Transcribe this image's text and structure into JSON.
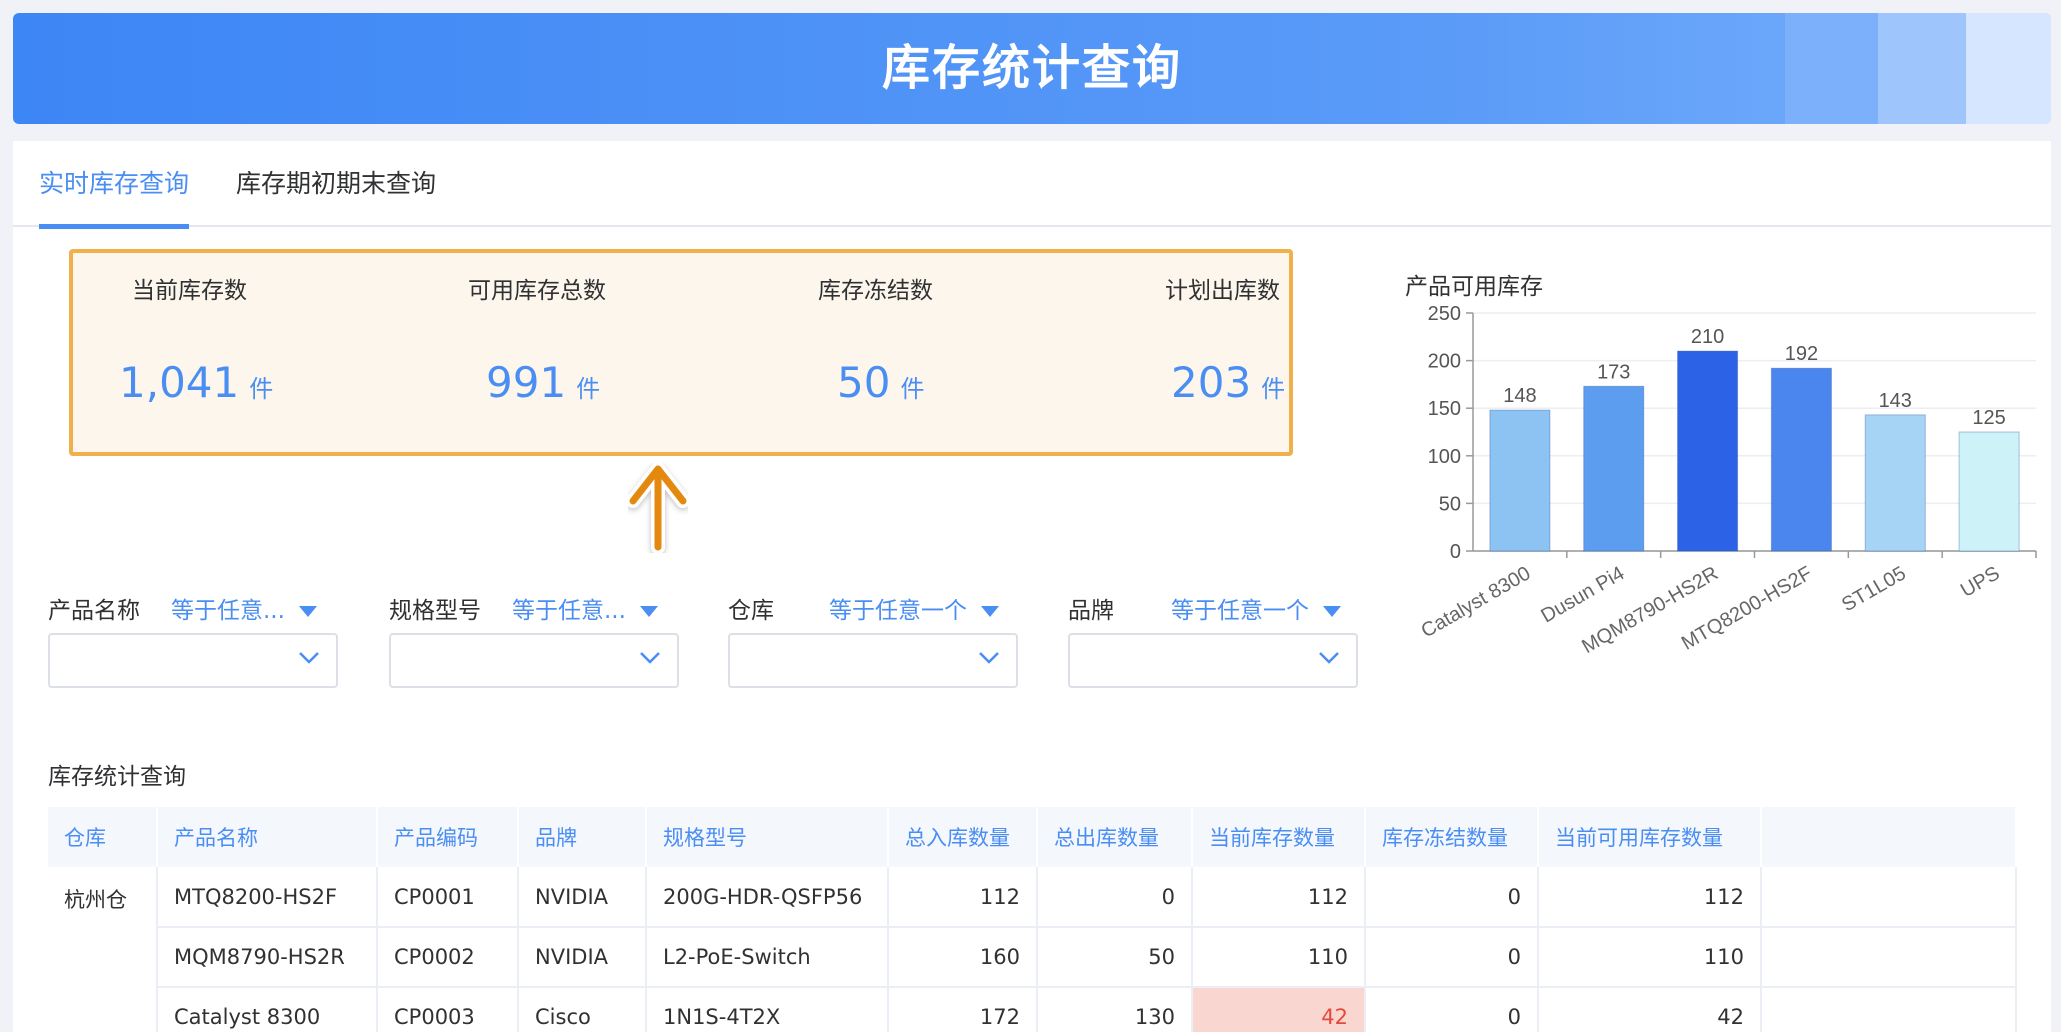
{
  "header": {
    "title": "库存统计查询"
  },
  "tabs": [
    {
      "label": "实时库存查询",
      "active": true
    },
    {
      "label": "库存期初期末查询",
      "active": false
    }
  ],
  "kpis": [
    {
      "label": "当前库存数",
      "value": "1,041",
      "unit": "件"
    },
    {
      "label": "可用库存总数",
      "value": "991",
      "unit": "件"
    },
    {
      "label": "库存冻结数",
      "value": "50",
      "unit": "件"
    },
    {
      "label": "计划出库数",
      "value": "203",
      "unit": "件"
    }
  ],
  "chart_data": {
    "type": "bar",
    "title": "产品可用库存",
    "categories": [
      "Catalyst 8300",
      "Dusun Pi4",
      "MQM8790-HS2R",
      "MTQ8200-HS2F",
      "ST1L05",
      "UPS"
    ],
    "values": [
      148,
      173,
      210,
      192,
      143,
      125
    ],
    "ylim": [
      0,
      250
    ],
    "yticks": [
      0,
      50,
      100,
      150,
      200,
      250
    ],
    "grid": true,
    "colors": [
      "#8cc3f3",
      "#5d9df0",
      "#2c63e6",
      "#4a86ee",
      "#a6d4f5",
      "#cdf3f8"
    ]
  },
  "filters": [
    {
      "label": "产品名称",
      "operator": "等于任意..."
    },
    {
      "label": "规格型号",
      "operator": "等于任意..."
    },
    {
      "label": "仓库",
      "operator": "等于任意一个"
    },
    {
      "label": "品牌",
      "operator": "等于任意一个"
    }
  ],
  "table": {
    "title": "库存统计查询",
    "columns": [
      "仓库",
      "产品名称",
      "产品编码",
      "品牌",
      "规格型号",
      "总入库数量",
      "总出库数量",
      "当前库存数量",
      "库存冻结数量",
      "当前可用库存数量",
      ""
    ],
    "rows": [
      [
        "杭州仓",
        "MTQ8200-HS2F",
        "CP0001",
        "NVIDIA",
        "200G-HDR-QSFP56",
        "112",
        "0",
        "112",
        "0",
        "112",
        ""
      ],
      [
        "",
        "MQM8790-HS2R",
        "CP0002",
        "NVIDIA",
        "L2-PoE-Switch",
        "160",
        "50",
        "110",
        "0",
        "110",
        ""
      ],
      [
        "",
        "Catalyst 8300",
        "CP0003",
        "Cisco",
        "1N1S-4T2X",
        "172",
        "130",
        "42",
        "0",
        "42",
        ""
      ]
    ]
  },
  "colors": {
    "accent": "#4a8ef3",
    "highlight_border": "#f0b04a",
    "warning": "#e5493b"
  }
}
